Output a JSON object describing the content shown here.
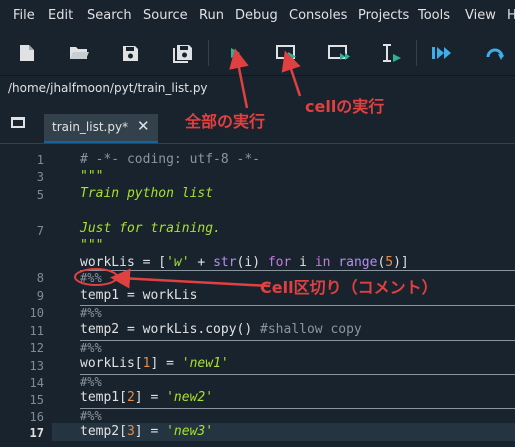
{
  "menu": [
    "File",
    "Edit",
    "Search",
    "Source",
    "Run",
    "Debug",
    "Consoles",
    "Projects",
    "Tools",
    "View",
    "He"
  ],
  "toolbar": {
    "icons": [
      "new-file-icon",
      "open-folder-icon",
      "save-icon",
      "save-all-icon",
      "run-icon",
      "run-cell-icon",
      "run-cell-advance-icon",
      "run-selection-icon",
      "debug-step-icon",
      "debug-icon"
    ],
    "accent": "#2ab398",
    "blue": "#3daee9"
  },
  "path": "/home/jhalfmoon/pyt/train_list.py",
  "tab": {
    "label": "train_list.py*",
    "close": "✕"
  },
  "editor": {
    "line_numbers": [
      "1",
      "3",
      "5",
      "7",
      "8",
      "9",
      "10",
      "11",
      "12",
      "13",
      "14",
      "15",
      "16",
      "17"
    ],
    "current_line": "17",
    "lines": {
      "l1": "# -*- coding: utf-8 -*-",
      "l2": "\"\"\"",
      "l3": "Train python list",
      "l4": "Just for training.",
      "l5": "\"\"\"",
      "l6_a": "workLis = [",
      "l6_b": "'w'",
      "l6_c": " + ",
      "l6_d": "str",
      "l6_e": "(i) ",
      "l6_f": "for",
      "l6_g": " i ",
      "l6_h": "in",
      "l6_i": " ",
      "l6_j": "range",
      "l6_k": "(",
      "l6_l": "5",
      "l6_m": ")]",
      "l7": "#%%",
      "l8": "temp1 = workLis",
      "l9": "#%%",
      "l10_a": "temp2 = workLis.copy() ",
      "l10_b": "#shallow copy",
      "l11": "#%%",
      "l12_a": "workLis[",
      "l12_b": "1",
      "l12_c": "] = ",
      "l12_d": "'new1'",
      "l13": "#%%",
      "l14_a": "temp1[",
      "l14_b": "2",
      "l14_c": "] = ",
      "l14_d": "'new2'",
      "l15": "#%%",
      "l16_a": "temp2[",
      "l16_b": "3",
      "l16_c": "] = ",
      "l16_d": "'new3'"
    }
  },
  "annotations": {
    "run_all": "全部の実行",
    "run_cell": "cellの実行",
    "cell_divider": "Cell区切り（コメント）",
    "color": "#e04040"
  }
}
